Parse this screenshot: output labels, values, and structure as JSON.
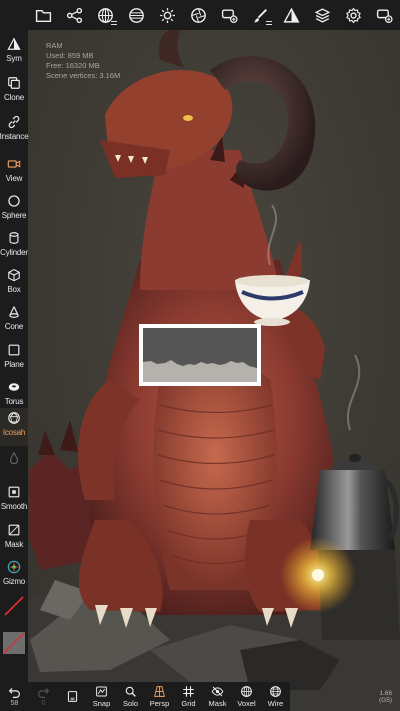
{
  "toolbar": {
    "items": [
      {
        "name": "files-button",
        "icon": "folder-icon"
      },
      {
        "name": "scene-button",
        "icon": "hierarchy-icon"
      },
      {
        "name": "postprocess-button",
        "icon": "sphere-grid-icon"
      },
      {
        "name": "material-button",
        "icon": "globe-icon"
      },
      {
        "name": "lighting-button",
        "icon": "sun-icon"
      },
      {
        "name": "camera-button",
        "icon": "shutter-icon"
      },
      {
        "name": "topology-button",
        "icon": "mesh-plus-icon"
      },
      {
        "name": "paint-button",
        "icon": "brush-icon"
      },
      {
        "name": "symmetry-tool-button",
        "icon": "triangle-mirror-icon"
      },
      {
        "name": "layers-button",
        "icon": "layers-icon"
      },
      {
        "name": "settings-button",
        "icon": "gear-icon"
      },
      {
        "name": "more-button",
        "icon": "add-window-icon"
      }
    ]
  },
  "sidebar": {
    "items": [
      {
        "label": "Sym",
        "icon": "symmetry-icon"
      },
      {
        "label": "Clone",
        "icon": "clone-icon"
      },
      {
        "label": "Instance",
        "icon": "link-icon"
      },
      {
        "label": "View",
        "icon": "camera-icon"
      },
      {
        "label": "Sphere",
        "icon": "circle-icon"
      },
      {
        "label": "Cylinder",
        "icon": "cylinder-icon"
      },
      {
        "label": "Box",
        "icon": "cube-icon"
      },
      {
        "label": "Cone",
        "icon": "cone-icon"
      },
      {
        "label": "Plane",
        "icon": "plane-icon"
      },
      {
        "label": "Torus",
        "icon": "torus-icon"
      },
      {
        "label": "Icosah",
        "icon": "icosahedron-icon"
      },
      {
        "label": "",
        "icon": "drop-icon"
      },
      {
        "label": "Smooth",
        "icon": "smooth-icon"
      },
      {
        "label": "Mask",
        "icon": "mask-icon"
      },
      {
        "label": "Gizmo",
        "icon": "gizmo-icon"
      }
    ]
  },
  "bottombar": {
    "undo_count": "58",
    "redo_count": "0",
    "items": [
      {
        "label": "Snap",
        "icon": "snap-icon"
      },
      {
        "label": "Solo",
        "icon": "solo-icon"
      },
      {
        "label": "Persp",
        "icon": "perspective-icon"
      },
      {
        "label": "Grid",
        "icon": "grid-icon"
      },
      {
        "label": "Mask",
        "icon": "mask-hide-icon"
      },
      {
        "label": "Voxel",
        "icon": "voxel-icon"
      },
      {
        "label": "Wire",
        "icon": "wireframe-icon"
      }
    ]
  },
  "info": {
    "ram": "RAM",
    "used": "Used: 859 MB",
    "free": "Free: 16320 MB",
    "vertices": "Scene vertices: 3.16M"
  },
  "version": {
    "line1": "1.66",
    "line2": "(G5)"
  },
  "colors": {
    "ui_bg": "#1c1c1c",
    "accent": "#f0a060",
    "viewport_bg": "#3d3a34"
  }
}
